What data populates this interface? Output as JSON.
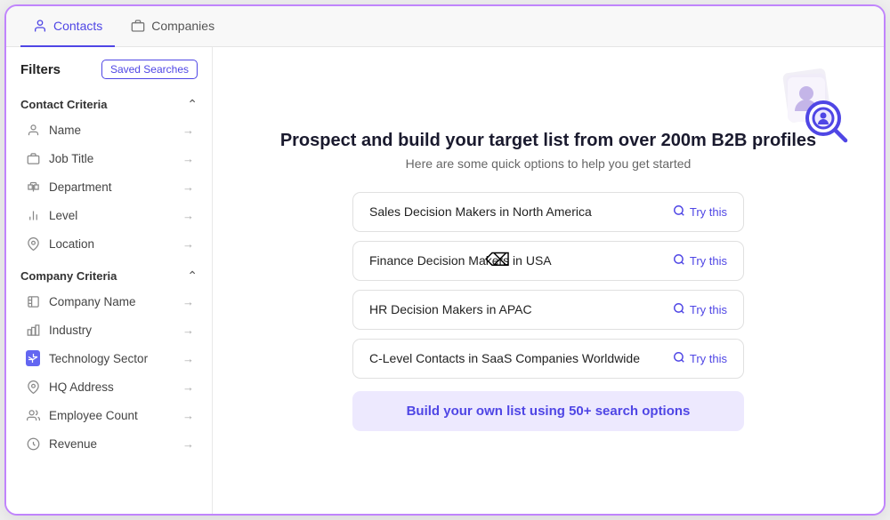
{
  "tabs": [
    {
      "id": "contacts",
      "label": "Contacts",
      "active": true
    },
    {
      "id": "companies",
      "label": "Companies",
      "active": false
    }
  ],
  "sidebar": {
    "filters_label": "Filters",
    "saved_searches_label": "Saved Searches",
    "contact_criteria": {
      "title": "Contact Criteria",
      "items": [
        {
          "label": "Name",
          "icon": "person"
        },
        {
          "label": "Job Title",
          "icon": "briefcase"
        },
        {
          "label": "Department",
          "icon": "department"
        },
        {
          "label": "Level",
          "icon": "level"
        },
        {
          "label": "Location",
          "icon": "location"
        }
      ]
    },
    "company_criteria": {
      "title": "Company Criteria",
      "items": [
        {
          "label": "Company Name",
          "icon": "building"
        },
        {
          "label": "Industry",
          "icon": "industry"
        },
        {
          "label": "Technology Sector",
          "icon": "tech",
          "special": true
        },
        {
          "label": "HQ Address",
          "icon": "location"
        },
        {
          "label": "Employee Count",
          "icon": "person"
        },
        {
          "label": "Revenue",
          "icon": "revenue"
        }
      ]
    }
  },
  "main": {
    "headline": "Prospect and build your target list from over 200m B2B profiles",
    "subheadline": "Here are some quick options to help you get started",
    "options": [
      {
        "label": "Sales Decision Makers in North America",
        "action": "Try this"
      },
      {
        "label": "Finance Decision Makers in USA",
        "action": "Try this"
      },
      {
        "label": "HR Decision Makers in APAC",
        "action": "Try this"
      },
      {
        "label": "C-Level Contacts in SaaS Companies Worldwide",
        "action": "Try this"
      }
    ],
    "build_btn": "Build your own list using 50+ search options"
  }
}
